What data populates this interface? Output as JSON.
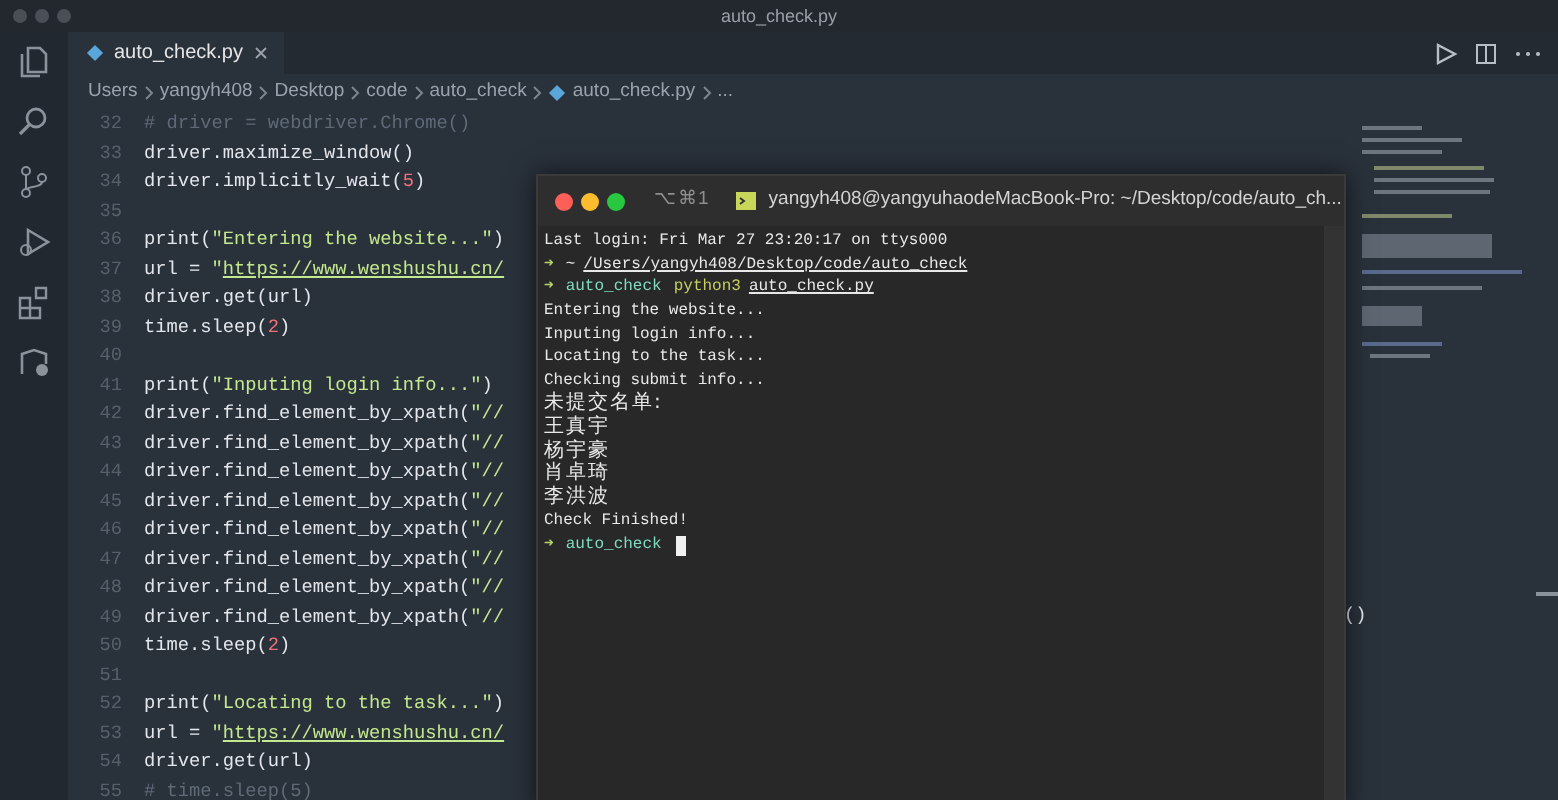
{
  "window": {
    "title": "auto_check.py"
  },
  "tabs": [
    {
      "label": "auto_check.py",
      "selected": true
    }
  ],
  "breadcrumbs": [
    {
      "label": "Users",
      "kind": "folder"
    },
    {
      "label": "yangyh408",
      "kind": "folder"
    },
    {
      "label": "Desktop",
      "kind": "folder"
    },
    {
      "label": "code",
      "kind": "folder"
    },
    {
      "label": "auto_check",
      "kind": "folder"
    },
    {
      "label": "auto_check.py",
      "kind": "file"
    },
    {
      "label": "...",
      "kind": "folder"
    }
  ],
  "editor": {
    "lines": [
      {
        "number": "32",
        "tokens": [
          {
            "text": "# driver = webdriver.Chrome()",
            "kind": "comment"
          }
        ]
      },
      {
        "number": "33",
        "tokens": [
          {
            "text": "driver.maximize_window()",
            "kind": "plain"
          }
        ]
      },
      {
        "number": "34",
        "tokens": [
          {
            "text": "driver.implicitly_wait(",
            "kind": "plain"
          },
          {
            "text": "5",
            "kind": "number"
          },
          {
            "text": ")",
            "kind": "plain"
          }
        ]
      },
      {
        "number": "35"
      },
      {
        "number": "36",
        "tokens": [
          {
            "text": "print(",
            "kind": "plain"
          },
          {
            "text": "\"Entering the website...\"",
            "kind": "string"
          },
          {
            "text": ")",
            "kind": "plain"
          }
        ]
      },
      {
        "number": "37",
        "tokens": [
          {
            "text": "url = ",
            "kind": "plain"
          },
          {
            "text": "\"",
            "kind": "string"
          },
          {
            "text": "https://www.wenshushu.cn/",
            "kind": "link"
          }
        ]
      },
      {
        "number": "38",
        "tokens": [
          {
            "text": "driver.get(url)",
            "kind": "plain"
          }
        ]
      },
      {
        "number": "39",
        "tokens": [
          {
            "text": "time.sleep(",
            "kind": "plain"
          },
          {
            "text": "2",
            "kind": "number"
          },
          {
            "text": ")",
            "kind": "plain"
          }
        ]
      },
      {
        "number": "40"
      },
      {
        "number": "41",
        "tokens": [
          {
            "text": "print(",
            "kind": "plain"
          },
          {
            "text": "\"Inputing login info...\"",
            "kind": "string"
          },
          {
            "text": ")",
            "kind": "plain"
          }
        ]
      },
      {
        "number": "42",
        "tokens": [
          {
            "text": "driver.find_element_by_xpath(",
            "kind": "plain"
          },
          {
            "text": "\"//",
            "kind": "string"
          }
        ]
      },
      {
        "number": "43",
        "tokens": [
          {
            "text": "driver.find_element_by_xpath(",
            "kind": "plain"
          },
          {
            "text": "\"//",
            "kind": "string"
          }
        ]
      },
      {
        "number": "44",
        "tokens": [
          {
            "text": "driver.find_element_by_xpath(",
            "kind": "plain"
          },
          {
            "text": "\"//",
            "kind": "string"
          }
        ]
      },
      {
        "number": "45",
        "tokens": [
          {
            "text": "driver.find_element_by_xpath(",
            "kind": "plain"
          },
          {
            "text": "\"//",
            "kind": "string"
          }
        ]
      },
      {
        "number": "46",
        "tokens": [
          {
            "text": "driver.find_element_by_xpath(",
            "kind": "plain"
          },
          {
            "text": "\"//",
            "kind": "string"
          }
        ]
      },
      {
        "number": "47",
        "tokens": [
          {
            "text": "driver.find_element_by_xpath(",
            "kind": "plain"
          },
          {
            "text": "\"//",
            "kind": "string"
          }
        ]
      },
      {
        "number": "48",
        "tokens": [
          {
            "text": "driver.find_element_by_xpath(",
            "kind": "plain"
          },
          {
            "text": "\"//",
            "kind": "string"
          }
        ]
      },
      {
        "number": "49",
        "tokens": [
          {
            "text": "driver.find_element_by_xpath(",
            "kind": "plain"
          },
          {
            "text": "\"//",
            "kind": "string"
          }
        ]
      },
      {
        "number": "50",
        "tokens": [
          {
            "text": "time.sleep(",
            "kind": "plain"
          },
          {
            "text": "2",
            "kind": "number"
          },
          {
            "text": ")",
            "kind": "plain"
          }
        ]
      },
      {
        "number": "51"
      },
      {
        "number": "52",
        "tokens": [
          {
            "text": "print(",
            "kind": "plain"
          },
          {
            "text": "\"Locating to the task...\"",
            "kind": "string"
          },
          {
            "text": ")",
            "kind": "plain"
          }
        ]
      },
      {
        "number": "53",
        "tokens": [
          {
            "text": "url = ",
            "kind": "plain"
          },
          {
            "text": "\"",
            "kind": "string"
          },
          {
            "text": "https://www.wenshushu.cn/",
            "kind": "link"
          }
        ]
      },
      {
        "number": "54",
        "tokens": [
          {
            "text": "driver.get(url)",
            "kind": "plain"
          }
        ]
      },
      {
        "number": "55",
        "tokens": [
          {
            "text": "# time.sleep(5)",
            "kind": "comment"
          }
        ]
      }
    ],
    "fragment": "()"
  },
  "terminal": {
    "shortcut": "⌥⌘1",
    "title": "yangyh408@yangyuhaodeMacBook-Pro: ~/Desktop/code/auto_ch...",
    "lines": [
      {
        "tokens": [
          {
            "text": "Last login: Fri Mar 27 23:20:17 on ttys000",
            "kind": "plain"
          }
        ]
      },
      {
        "tokens": [
          {
            "text": "➜",
            "kind": "arrow"
          },
          {
            "text": "~",
            "kind": "plain"
          },
          {
            "text": "/Users/yangyh408/Desktop/code/auto_check",
            "kind": "path"
          }
        ]
      },
      {
        "tokens": [
          {
            "text": "➜",
            "kind": "arrow"
          },
          {
            "text": "auto_check",
            "kind": "dir"
          },
          {
            "text": "python3",
            "kind": "cmd"
          },
          {
            "text": "auto_check.py",
            "kind": "path"
          }
        ]
      },
      {
        "tokens": [
          {
            "text": "Entering the website...",
            "kind": "plain"
          }
        ]
      },
      {
        "tokens": [
          {
            "text": "Inputing login info...",
            "kind": "plain"
          }
        ]
      },
      {
        "tokens": [
          {
            "text": "Locating to the task...",
            "kind": "plain"
          }
        ]
      },
      {
        "tokens": [
          {
            "text": "Checking submit info...",
            "kind": "plain"
          }
        ]
      },
      {
        "tokens": [
          {
            "text": "未提交名单:",
            "kind": "cjk"
          }
        ]
      },
      {
        "tokens": [
          {
            "text": "王真宇",
            "kind": "cjk"
          }
        ]
      },
      {
        "tokens": [
          {
            "text": "杨宇豪",
            "kind": "cjk"
          }
        ]
      },
      {
        "tokens": [
          {
            "text": "肖卓琦",
            "kind": "cjk"
          }
        ]
      },
      {
        "tokens": [
          {
            "text": "李洪波",
            "kind": "cjk"
          }
        ]
      },
      {
        "tokens": [
          {
            "text": "Check Finished!",
            "kind": "plain"
          }
        ]
      },
      {
        "tokens": [
          {
            "text": "➜",
            "kind": "arrow"
          },
          {
            "text": "auto_check",
            "kind": "dir"
          }
        ],
        "cursor": true
      }
    ]
  }
}
